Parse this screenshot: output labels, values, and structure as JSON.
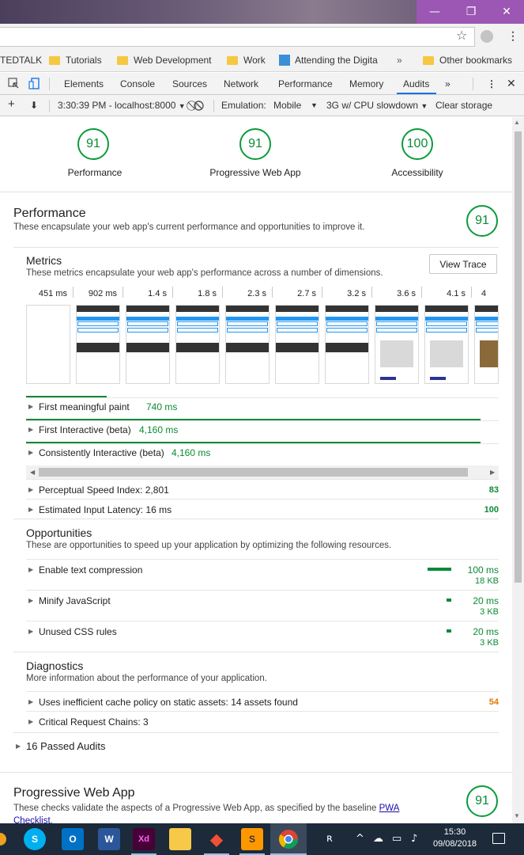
{
  "window": {
    "min_icon": "—",
    "max_icon": "❐",
    "close_icon": "✕"
  },
  "bookmarks": [
    {
      "label": "TEDTALK",
      "type": "text"
    },
    {
      "label": "Tutorials",
      "type": "folder"
    },
    {
      "label": "Web Development",
      "type": "folder"
    },
    {
      "label": "Work",
      "type": "folder"
    },
    {
      "label": "Attending the Digita",
      "type": "site"
    },
    {
      "label": "»",
      "type": "chevron"
    },
    {
      "label": "Other bookmarks",
      "type": "folder"
    }
  ],
  "devtools": {
    "tabs": [
      "Elements",
      "Console",
      "Sources",
      "Network",
      "Performance",
      "Memory",
      "Audits"
    ],
    "more": "»",
    "active_tab": "Audits"
  },
  "audits_toolbar": {
    "plus": "+",
    "download": "⬇",
    "report": "3:30:39 PM - localhost:8000",
    "report_caret": "▼",
    "emulation_label": "Emulation:",
    "emulation_value": "Mobile",
    "emulation_caret": "▼",
    "throttling": "3G w/ CPU slowdown",
    "throttling_caret": "▼",
    "clear_storage": "Clear storage"
  },
  "summary": [
    {
      "score": "91",
      "label": "Performance"
    },
    {
      "score": "91",
      "label": "Progressive Web App"
    },
    {
      "score": "100",
      "label": "Accessibility"
    }
  ],
  "performance": {
    "title": "Performance",
    "description": "These encapsulate your web app's current performance and opportunities to improve it.",
    "score": "91",
    "metrics": {
      "title": "Metrics",
      "description": "These metrics encapsulate your web app's performance across a number of dimensions.",
      "view_trace": "View Trace",
      "timestamps": [
        "451 ms",
        "902 ms",
        "1.4 s",
        "1.8 s",
        "2.3 s",
        "2.7 s",
        "3.2 s",
        "3.6 s",
        "4.1 s",
        "4"
      ],
      "rows": [
        {
          "label": "First meaningful paint",
          "value": "740 ms"
        },
        {
          "label": "First Interactive (beta)",
          "value": "4,160 ms"
        },
        {
          "label": "Consistently Interactive (beta)",
          "value": "4,160 ms"
        }
      ],
      "scored": [
        {
          "label": "Perceptual Speed Index: 2,801",
          "score": "83"
        },
        {
          "label": "Estimated Input Latency: 16 ms",
          "score": "100"
        }
      ]
    },
    "opportunities": {
      "title": "Opportunities",
      "description": "These are opportunities to speed up your application by optimizing the following resources.",
      "items": [
        {
          "label": "Enable text compression",
          "ms": "100 ms",
          "kb": "18 KB"
        },
        {
          "label": "Minify JavaScript",
          "ms": "20 ms",
          "kb": "3 KB"
        },
        {
          "label": "Unused CSS rules",
          "ms": "20 ms",
          "kb": "3 KB"
        }
      ]
    },
    "diagnostics": {
      "title": "Diagnostics",
      "description": "More information about the performance of your application.",
      "items": [
        {
          "label": "Uses inefficient cache policy on static assets: 14 assets found",
          "score": "54"
        },
        {
          "label": "Critical Request Chains: 3",
          "score": ""
        }
      ]
    },
    "passed": "16 Passed Audits"
  },
  "pwa": {
    "title": "Progressive Web App",
    "description_prefix": "These checks validate the aspects of a Progressive Web App, as specified by the baseline",
    "link_part1": "PWA",
    "link_part2": "Checklist",
    "link_suffix": ".",
    "score": "91"
  },
  "taskbar": {
    "time": "15:30",
    "date": "09/08/2018",
    "apps": [
      {
        "name": "skype",
        "glyph": "S",
        "color": "#00aff0"
      },
      {
        "name": "outlook",
        "glyph": "O",
        "color": "#0072c6"
      },
      {
        "name": "word",
        "glyph": "W",
        "color": "#2b579a"
      },
      {
        "name": "xd",
        "glyph": "Xd",
        "color": "#470137"
      },
      {
        "name": "explorer",
        "glyph": "",
        "color": "#f7c948"
      },
      {
        "name": "git",
        "glyph": "◆",
        "color": "#f05033"
      },
      {
        "name": "sublime",
        "glyph": "S",
        "color": "#ff9800"
      },
      {
        "name": "chrome",
        "glyph": "",
        "color": "#db4437"
      }
    ]
  },
  "colors": {
    "pass": "#0b8a36",
    "average": "#e67700",
    "link": "#1a0dab",
    "tab_active": "#1a73e8"
  }
}
